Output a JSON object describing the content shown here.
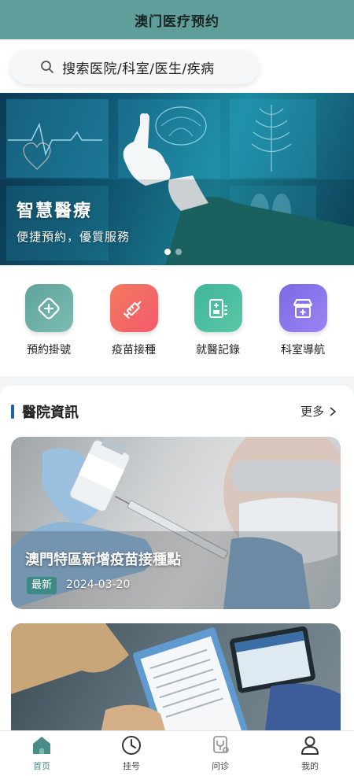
{
  "header": {
    "title": "澳门医疗预约"
  },
  "search": {
    "placeholder": "搜索医院/科室/医生/疾病",
    "icon": "search-icon"
  },
  "banner": {
    "title": "智慧醫療",
    "subtitle": "便捷預約，優質服務",
    "slide_count": 2,
    "active_slide": 1
  },
  "quick_actions": [
    {
      "label": "預約掛號",
      "icon": "plus-diamond-icon",
      "color_from": "#5fa39b",
      "color_to": "#7cbcb3"
    },
    {
      "label": "疫苗接種",
      "icon": "syringe-icon",
      "color_from": "#f47a5e",
      "color_to": "#f2596e"
    },
    {
      "label": "就醫記錄",
      "icon": "medical-record-icon",
      "color_from": "#3fb69a",
      "color_to": "#5bc8a8"
    },
    {
      "label": "科室導航",
      "icon": "clinic-store-icon",
      "color_from": "#7b6ae6",
      "color_to": "#9b83f2"
    }
  ],
  "news": {
    "title": "醫院資訊",
    "more_label": "更多",
    "items": [
      {
        "title": "澳門特區新增疫苗接種點",
        "tag": "最新",
        "date": "2024-03-20"
      }
    ]
  },
  "tabbar": {
    "items": [
      {
        "label": "首页",
        "icon": "home-icon",
        "active": true
      },
      {
        "label": "挂号",
        "icon": "clock-icon",
        "active": false
      },
      {
        "label": "问诊",
        "icon": "stethoscope-icon",
        "active": false
      },
      {
        "label": "我的",
        "icon": "user-icon",
        "active": false
      }
    ]
  },
  "colors": {
    "header_bg": "#5f9e9a",
    "accent": "#4a8d87",
    "section_bar": "#1f5fa8"
  }
}
